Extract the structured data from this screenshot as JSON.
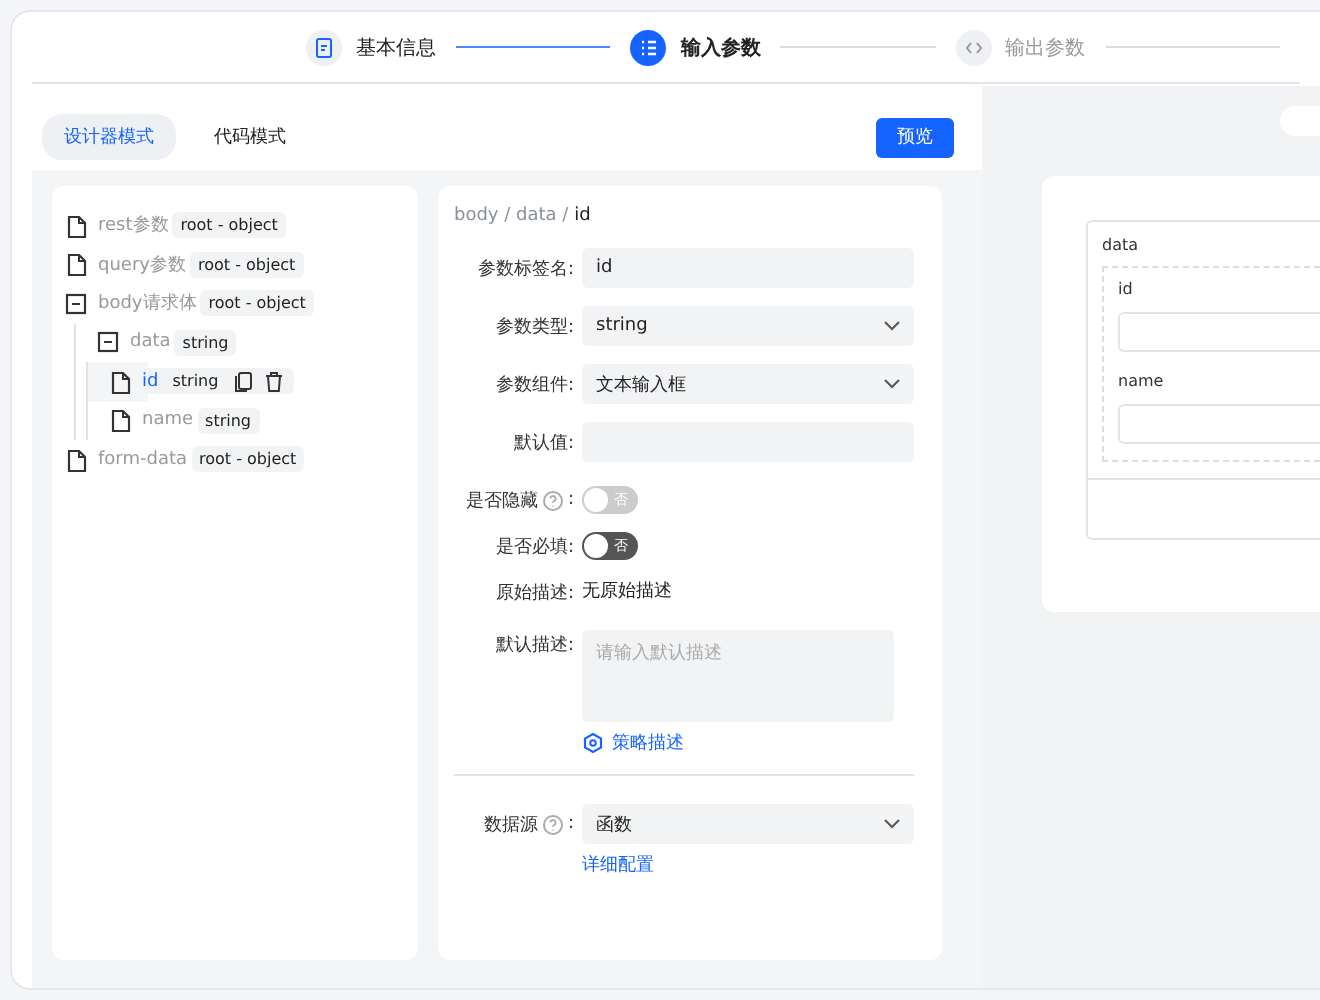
{
  "steps": [
    {
      "label": "基本信息",
      "completed": true,
      "selected": false
    },
    {
      "label": "输入参数",
      "completed": false,
      "selected": true
    },
    {
      "label": "输出参数",
      "completed": false,
      "selected": false
    }
  ],
  "mode_tabs": [
    {
      "label": "设计器模式",
      "selected": true
    },
    {
      "label": "代码模式",
      "selected": false
    }
  ],
  "preview_button": "预览",
  "tree": [
    {
      "label": "rest参数",
      "type": "root - object",
      "selected": false
    },
    {
      "label": "query参数",
      "type": "root - object",
      "selected": false
    },
    {
      "label": "body请求体",
      "type": "root - object",
      "selected": false,
      "expanded": true,
      "children": [
        {
          "label": "data",
          "type": "string",
          "selected": false,
          "expanded": true,
          "children": [
            {
              "label": "id",
              "type": "string",
              "selected": true
            },
            {
              "label": "name",
              "type": "string",
              "selected": false
            }
          ]
        }
      ]
    },
    {
      "label": "form-data",
      "type": "root - object",
      "selected": false
    }
  ],
  "form": {
    "breadcrumb": [
      "body",
      "data",
      "id"
    ],
    "breadcrumb_separator": "/",
    "fields": [
      {
        "kind": "input",
        "label": "参数标签名:",
        "value": "id"
      },
      {
        "kind": "select",
        "label": "参数类型:",
        "value": "string"
      },
      {
        "kind": "select",
        "label": "参数组件:",
        "value": "文本输入框"
      },
      {
        "kind": "input",
        "label": "默认值:"
      },
      {
        "kind": "switch",
        "label": "是否隐藏",
        "help": true,
        "label_suffix": ":",
        "on": false,
        "disabled": true,
        "switch_text": "否"
      },
      {
        "kind": "switch",
        "label": "是否必填:",
        "on": false,
        "disabled": false,
        "switch_text": "否"
      },
      {
        "kind": "text",
        "label": "原始描述:",
        "value": "无原始描述"
      },
      {
        "kind": "textarea",
        "label": "默认描述:",
        "placeholder": "请输入默认描述",
        "link": "策略描述"
      },
      {
        "kind": "divider"
      },
      {
        "kind": "select",
        "label": "数据源",
        "help": true,
        "label_suffix": ":",
        "value": "函数",
        "link": "详细配置"
      }
    ]
  },
  "preview": {
    "group": "data",
    "fields": [
      "id",
      "name"
    ]
  }
}
